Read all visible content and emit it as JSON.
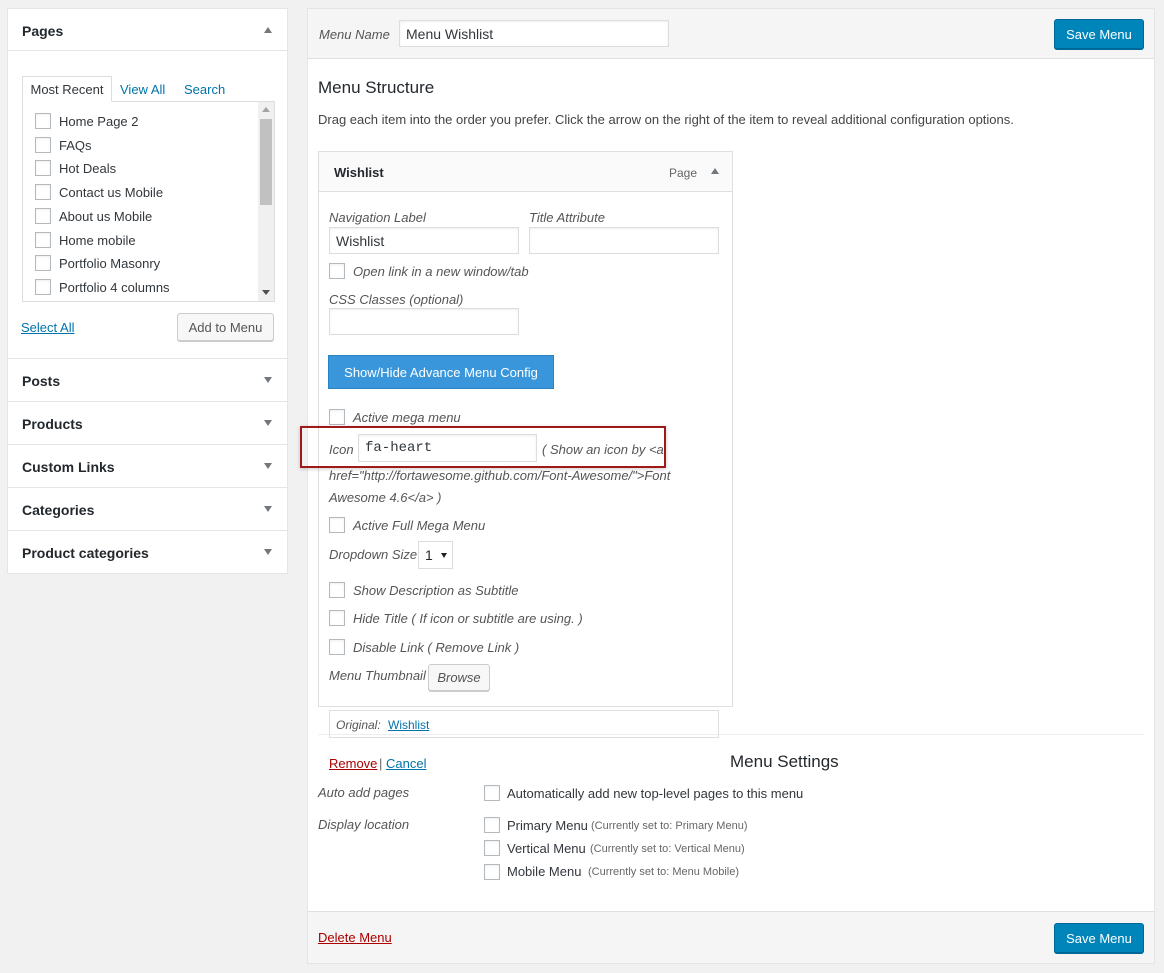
{
  "sidebar": {
    "pages": {
      "title": "Pages",
      "tabs": [
        "Most Recent",
        "View All",
        "Search"
      ],
      "items": [
        "Home Page 2",
        "FAQs",
        "Hot Deals",
        "Contact us Mobile",
        "About us Mobile",
        "Home mobile",
        "Portfolio Masonry",
        "Portfolio 4 columns"
      ],
      "select_all": "Select All",
      "add_to_menu": "Add to Menu"
    },
    "sections": [
      "Posts",
      "Products",
      "Custom Links",
      "Categories",
      "Product categories"
    ]
  },
  "header": {
    "menu_name_label": "Menu Name",
    "menu_name_value": "Menu Wishlist",
    "save_label": "Save Menu"
  },
  "structure": {
    "title": "Menu Structure",
    "description": "Drag each item into the order you prefer. Click the arrow on the right of the item to reveal additional configuration options."
  },
  "item": {
    "title": "Wishlist",
    "type": "Page",
    "nav_label_label": "Navigation Label",
    "nav_label_value": "Wishlist",
    "title_attr_label": "Title Attribute",
    "title_attr_value": "",
    "open_new_window": "Open link in a new window/tab",
    "css_classes_label": "CSS Classes (optional)",
    "advance_button": "Show/Hide Advance Menu Config",
    "active_mega": "Active mega menu",
    "icon_label": "Icon",
    "icon_value": "fa-heart",
    "icon_help_1": "( Show an icon by <a",
    "icon_help_2": "href=\"http://fortawesome.github.com/Font-Awesome/\">Font",
    "icon_help_3": "Awesome 4.6</a> )",
    "active_full_mega": "Active Full Mega Menu",
    "dropdown_size_label": "Dropdown Size",
    "dropdown_size_value": "1",
    "show_desc": "Show Description as Subtitle",
    "hide_title": "Hide Title ( If icon or subtitle are using. )",
    "disable_link": "Disable Link ( Remove Link )",
    "thumbnail_label": "Menu Thumbnail",
    "browse": "Browse",
    "original_label": "Original:",
    "original_link": "Wishlist",
    "remove": "Remove",
    "separator": "|",
    "cancel": "Cancel"
  },
  "settings": {
    "title": "Menu Settings",
    "auto_add_label": "Auto add pages",
    "auto_add_option": "Automatically add new top-level pages to this menu",
    "display_location_label": "Display location",
    "locations": [
      {
        "name": "Primary Menu",
        "note": "(Currently set to: Primary Menu)"
      },
      {
        "name": "Vertical Menu",
        "note": "(Currently set to: Vertical Menu)"
      },
      {
        "name": "Mobile Menu",
        "note": "(Currently set to: Menu Mobile)"
      }
    ]
  },
  "footer": {
    "delete": "Delete Menu",
    "save_label": "Save Menu"
  },
  "colors": {
    "primary": "#0085ba",
    "highlight": "#a01919",
    "advance": "#3a96db"
  }
}
